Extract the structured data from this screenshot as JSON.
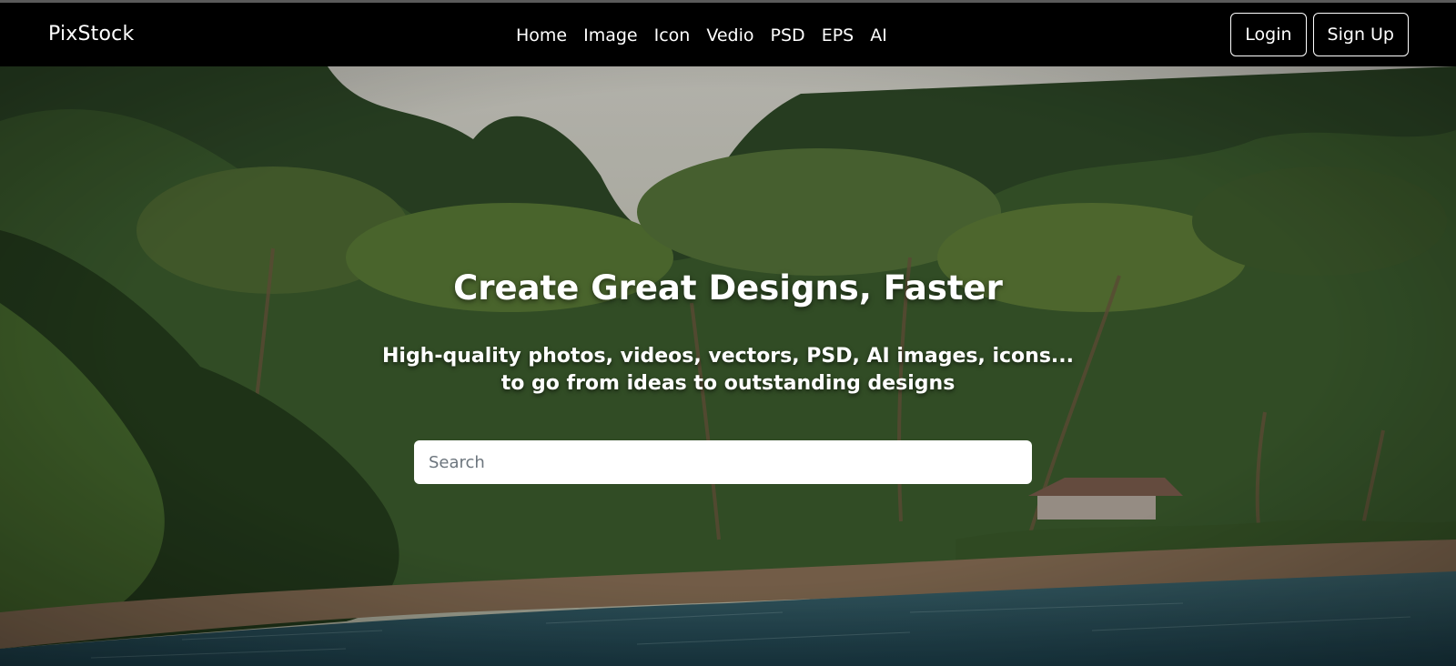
{
  "navbar": {
    "brand": "PixStock",
    "links": [
      "Home",
      "Image",
      "Icon",
      "Vedio",
      "PSD",
      "EPS",
      "AI"
    ],
    "login_label": "Login",
    "signup_label": "Sign Up"
  },
  "hero": {
    "headline": "Create Great Designs, Faster",
    "subline_1": "High-quality photos, videos, vectors, PSD, AI images, icons...",
    "subline_2": "to go from ideas to outstanding designs",
    "search_placeholder": "Search",
    "background_image": "tropical-beach-palm-forest"
  },
  "colors": {
    "navbar_bg": "#000000",
    "text": "#ffffff",
    "search_bg": "#ffffff"
  }
}
